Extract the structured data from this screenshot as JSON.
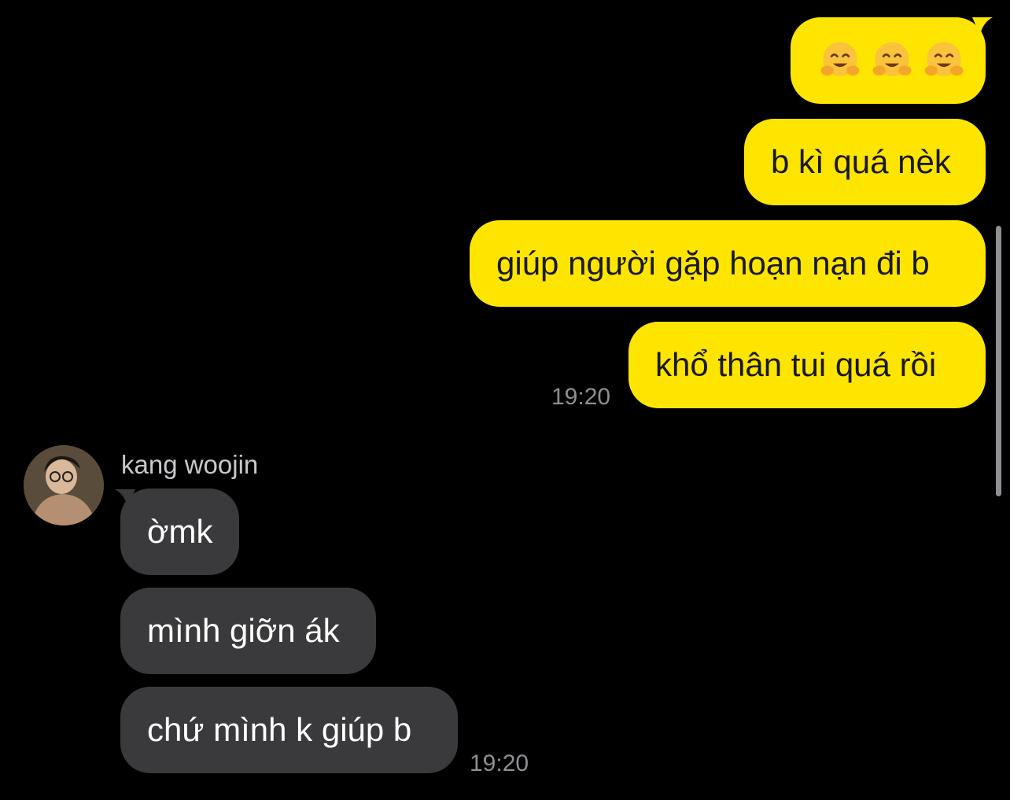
{
  "outgoing": {
    "emoji_message": [
      "hugging-face",
      "hugging-face",
      "hugging-face"
    ],
    "messages": [
      "b kì quá nèk",
      "giúp người gặp hoạn nạn đi b",
      "khổ thân tui quá rồi"
    ],
    "time": "19:20"
  },
  "incoming": {
    "sender": "kang woojin",
    "messages": [
      "ờmk",
      "mình giỡn ák",
      "chứ mình k giúp b"
    ],
    "time": "19:20"
  },
  "colors": {
    "outgoing_bubble": "#FEE500",
    "incoming_bubble": "#3A3A3C",
    "background": "#000000",
    "timestamp": "#8E8E93"
  }
}
